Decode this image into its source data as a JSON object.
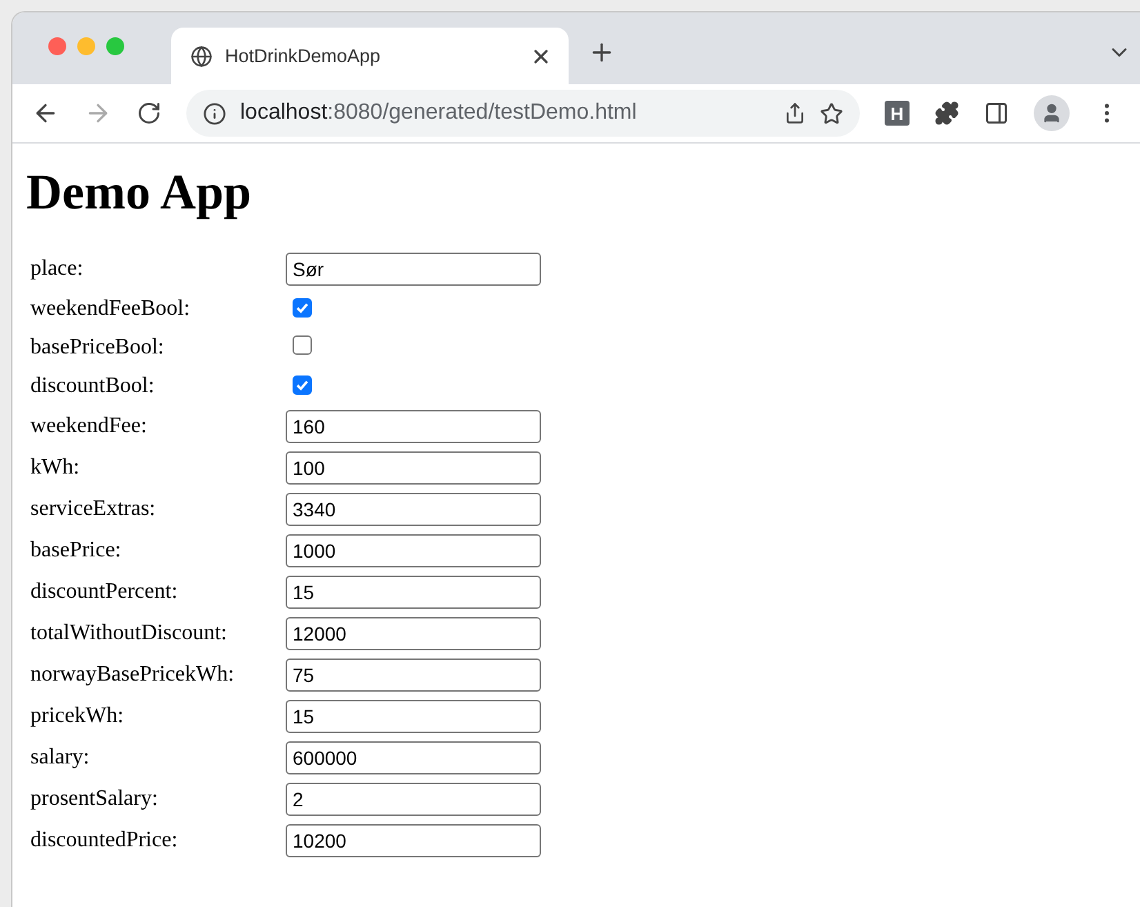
{
  "tab": {
    "title": "HotDrinkDemoApp",
    "selected": true
  },
  "address": {
    "host": "localhost",
    "path": ":8080/generated/testDemo.html"
  },
  "extension_badge": "H",
  "heading": "Demo App",
  "fields": [
    {
      "kind": "text",
      "label": "place:",
      "value": "Sør"
    },
    {
      "kind": "checkbox",
      "label": "weekendFeeBool:",
      "checked": true
    },
    {
      "kind": "checkbox",
      "label": "basePriceBool:",
      "checked": false
    },
    {
      "kind": "checkbox",
      "label": "discountBool:",
      "checked": true
    },
    {
      "kind": "text",
      "label": "weekendFee:",
      "value": "160"
    },
    {
      "kind": "text",
      "label": "kWh:",
      "value": "100"
    },
    {
      "kind": "text",
      "label": "serviceExtras:",
      "value": "3340"
    },
    {
      "kind": "text",
      "label": "basePrice:",
      "value": "1000"
    },
    {
      "kind": "text",
      "label": "discountPercent:",
      "value": "15"
    },
    {
      "kind": "text",
      "label": "totalWithoutDiscount:",
      "value": "12000"
    },
    {
      "kind": "text",
      "label": "norwayBasePricekWh:",
      "value": "75"
    },
    {
      "kind": "text",
      "label": "pricekWh:",
      "value": "15"
    },
    {
      "kind": "text",
      "label": "salary:",
      "value": "600000"
    },
    {
      "kind": "text",
      "label": "prosentSalary:",
      "value": "2"
    },
    {
      "kind": "text",
      "label": "discountedPrice:",
      "value": "10200"
    }
  ]
}
